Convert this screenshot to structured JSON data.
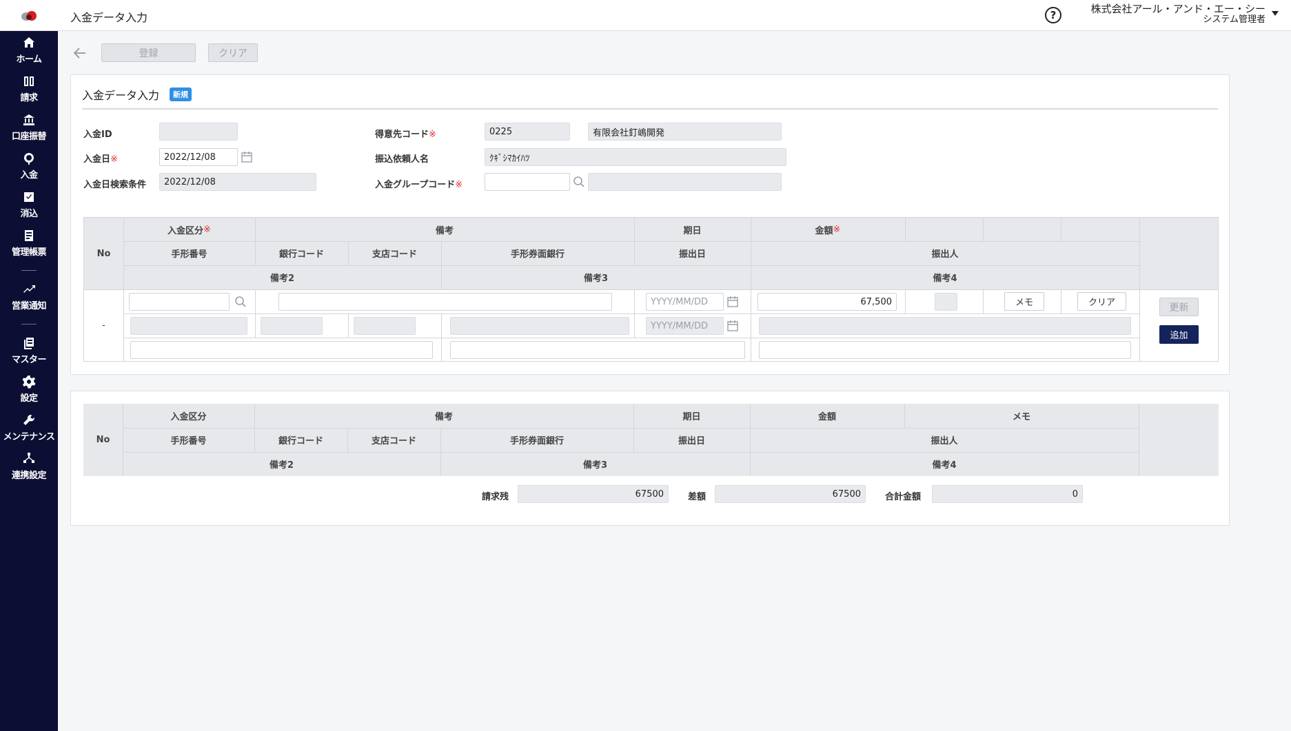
{
  "header": {
    "title": "入金データ入力",
    "help_glyph": "?",
    "company": "株式会社アール・アンド・エー・シー",
    "role": "システム管理者"
  },
  "sidebar": {
    "items": [
      {
        "label": "ホーム",
        "icon": "home-icon"
      },
      {
        "label": "請求",
        "icon": "book-icon"
      },
      {
        "label": "口座振替",
        "icon": "bank-icon"
      },
      {
        "label": "入金",
        "icon": "payment-icon"
      },
      {
        "label": "消込",
        "icon": "check-icon"
      },
      {
        "label": "管理帳票",
        "icon": "report-icon"
      },
      {
        "label": "営業通知",
        "icon": "notify-icon"
      },
      {
        "label": "マスター",
        "icon": "master-icon"
      },
      {
        "label": "設定",
        "icon": "gear-icon"
      },
      {
        "label": "メンテナンス",
        "icon": "wrench-icon"
      },
      {
        "label": "連携設定",
        "icon": "network-icon"
      }
    ]
  },
  "toolbar": {
    "register_label": "登録",
    "clear_label": "クリア"
  },
  "form": {
    "title": "入金データ入力",
    "badge": "新規",
    "required_mark": "※",
    "payment_id_label": "入金ID",
    "payment_id_value": "",
    "payment_date_label": "入金日",
    "payment_date_value": "2022/12/08",
    "date_search_label": "入金日検索条件",
    "date_search_value": "2022/12/08",
    "customer_code_label": "得意先コード",
    "customer_code_value": "0225",
    "customer_name_value": "有限会社釘嶋開発",
    "requester_label": "振込依頼人名",
    "requester_value": "ｸｷﾞｼﾏｶｲﾊﾂ",
    "group_code_label": "入金グループコード",
    "group_code_value": "",
    "group_name_value": ""
  },
  "entry_table": {
    "headers": {
      "no": "No",
      "category": "入金区分",
      "remarks": "備考",
      "due_date": "期日",
      "amount": "金額",
      "bill_number": "手形番号",
      "bank_code": "銀行コード",
      "branch_code": "支店コード",
      "bill_bank": "手形券面銀行",
      "issue_date": "振出日",
      "drawer": "振出人",
      "remarks2": "備考2",
      "remarks3": "備考3",
      "remarks4": "備考4"
    },
    "row": {
      "no": "-",
      "amount": "67,500",
      "date_placeholder": "YYYY/MM/DD",
      "memo_button": "メモ",
      "clear_button": "クリア",
      "update_button": "更新",
      "add_button": "追加"
    }
  },
  "list_table": {
    "headers": {
      "no": "No",
      "category": "入金区分",
      "remarks": "備考",
      "due_date": "期日",
      "amount": "金額",
      "memo": "メモ",
      "bill_number": "手形番号",
      "bank_code": "銀行コード",
      "branch_code": "支店コード",
      "bill_bank": "手形券面銀行",
      "issue_date": "振出日",
      "drawer": "振出人",
      "remarks2": "備考2",
      "remarks3": "備考3",
      "remarks4": "備考4"
    }
  },
  "totals": {
    "balance_label": "請求残",
    "balance_value": "67500",
    "diff_label": "差額",
    "diff_value": "67500",
    "total_label": "合計金額",
    "total_value": "0"
  }
}
